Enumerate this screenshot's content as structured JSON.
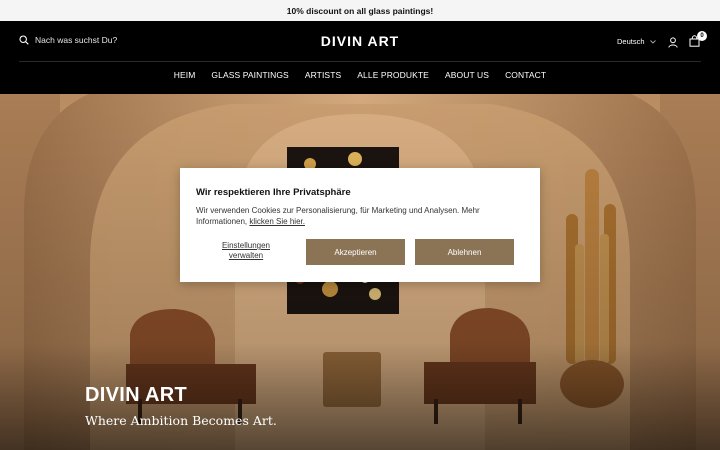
{
  "announcement": "10% discount on all glass paintings!",
  "header": {
    "search_placeholder": "Nach was suchst Du?",
    "logo": "DIVIN ART",
    "language": "Deutsch",
    "cart_count": "0"
  },
  "nav": {
    "items": [
      {
        "label": "HEIM"
      },
      {
        "label": "GLASS PAINTINGS"
      },
      {
        "label": "ARTISTS"
      },
      {
        "label": "ALLE PRODUKTE"
      },
      {
        "label": "ABOUT US"
      },
      {
        "label": "CONTACT"
      }
    ]
  },
  "hero": {
    "title": "DIVIN ART",
    "subtitle": "Where Ambition Becomes Art."
  },
  "cookie": {
    "title": "Wir respektieren Ihre Privatsphäre",
    "text": "Wir verwenden Cookies zur Personalisierung, für Marketing und Analysen. Mehr Informationen, ",
    "link": "klicken Sie hier.",
    "settings": "Einstellungen verwalten",
    "accept": "Akzeptieren",
    "decline": "Ablehnen"
  },
  "colors": {
    "button": "#8b7355",
    "header_bg": "#000000",
    "announcement_bg": "#f5f5f5"
  },
  "icons": [
    "search-icon",
    "chevron-down-icon",
    "user-icon",
    "cart-icon"
  ]
}
